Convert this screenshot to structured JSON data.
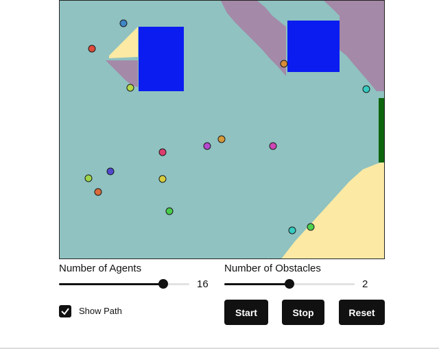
{
  "colors": {
    "background": "#8fc2c0",
    "purple_region": "#a489a8",
    "yellow_region": "#fce9a4",
    "obstacle": "#0a1cf0",
    "goal": "#0d650d",
    "control": "#111111"
  },
  "controls": {
    "agents_label": "Number of Agents",
    "agents_value": "16",
    "agents_fraction": 0.8,
    "obstacles_label": "Number of Obstacles",
    "obstacles_value": "2",
    "obstacles_fraction": 0.5,
    "show_path_label": "Show Path",
    "show_path_checked": true,
    "start_label": "Start",
    "stop_label": "Stop",
    "reset_label": "Reset"
  },
  "agents": [
    {
      "color": "#3f86c6"
    },
    {
      "color": "#df4b3a"
    },
    {
      "color": "#b6d94a"
    },
    {
      "color": "#d88c3a"
    },
    {
      "color": "#35cbc0"
    },
    {
      "color": "#dc3d6e"
    },
    {
      "color": "#b54ad0"
    },
    {
      "color": "#d49a3c"
    },
    {
      "color": "#cf46b6"
    },
    {
      "color": "#5049cf"
    },
    {
      "color": "#9ed54a"
    },
    {
      "color": "#d96a3a"
    },
    {
      "color": "#d6cc3e"
    },
    {
      "color": "#49cc4c"
    },
    {
      "color": "#35cbc0"
    },
    {
      "color": "#4fd24e"
    }
  ]
}
